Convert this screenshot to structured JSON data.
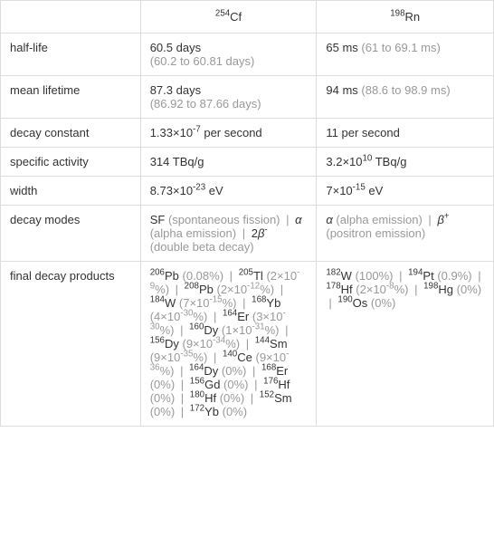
{
  "headers": {
    "col1_mass": "254",
    "col1_symbol": "Cf",
    "col2_mass": "198",
    "col2_symbol": "Rn"
  },
  "rows": {
    "halflife": {
      "label": "half-life",
      "col1_main": "60.5 days",
      "col1_sub": "(60.2 to 60.81 days)",
      "col2_main": "65 ms",
      "col2_sub": "(61 to 69.1 ms)"
    },
    "meanlifetime": {
      "label": "mean lifetime",
      "col1_main": "87.3 days",
      "col1_sub": "(86.92 to 87.66 days)",
      "col2_main": "94 ms",
      "col2_sub": "(88.6 to 98.9 ms)"
    },
    "decayconstant": {
      "label": "decay constant",
      "col1_base": "1.33×10",
      "col1_exp": "-7",
      "col1_unit": " per second",
      "col2": "11 per second"
    },
    "specificactivity": {
      "label": "specific activity",
      "col1": "314 TBq/g",
      "col2_base": "3.2×10",
      "col2_exp": "10",
      "col2_unit": " TBq/g"
    },
    "width": {
      "label": "width",
      "col1_base": "8.73×10",
      "col1_exp": "-23",
      "col1_unit": " eV",
      "col2_base": "7×10",
      "col2_exp": "-15",
      "col2_unit": " eV"
    },
    "decaymodes": {
      "label": "decay modes",
      "col1_p1a": "SF",
      "col1_p1b": " (spontaneous fission)",
      "col1_p2a": "α",
      "col1_p2b": " (alpha emission)",
      "col1_p3a": "2",
      "col1_p3b": "β",
      "col1_p3sup": "-",
      "col1_p3c": " (double beta decay)",
      "col2_p1a": "α",
      "col2_p1b": " (alpha emission)",
      "col2_p2a": "β",
      "col2_p2sup": "+",
      "col2_p2b": " (positron emission)"
    },
    "finaldecay": {
      "label": "final decay products",
      "sep": "|",
      "col1": [
        {
          "mass": "206",
          "sym": "Pb",
          "pct": "(0.08%)"
        },
        {
          "mass": "205",
          "sym": "Tl",
          "pct_pre": "(2×10",
          "pct_exp": "-9",
          "pct_post": "%)"
        },
        {
          "mass": "208",
          "sym": "Pb",
          "pct_pre": "(2×10",
          "pct_exp": "-12",
          "pct_post": "%)"
        },
        {
          "mass": "184",
          "sym": "W",
          "pct_pre": "(7×10",
          "pct_exp": "-15",
          "pct_post": "%)"
        },
        {
          "mass": "168",
          "sym": "Yb",
          "pct_pre": "(4×10",
          "pct_exp": "-30",
          "pct_post": "%)"
        },
        {
          "mass": "164",
          "sym": "Er",
          "pct_pre": "(3×10",
          "pct_exp": "-30",
          "pct_post": "%)"
        },
        {
          "mass": "160",
          "sym": "Dy",
          "pct_pre": "(1×10",
          "pct_exp": "-31",
          "pct_post": "%)"
        },
        {
          "mass": "156",
          "sym": "Dy",
          "pct_pre": "(9×10",
          "pct_exp": "-34",
          "pct_post": "%)"
        },
        {
          "mass": "144",
          "sym": "Sm",
          "pct_pre": "(9×10",
          "pct_exp": "-35",
          "pct_post": "%)"
        },
        {
          "mass": "140",
          "sym": "Ce",
          "pct_pre": "(9×10",
          "pct_exp": "-36",
          "pct_post": "%)"
        },
        {
          "mass": "164",
          "sym": "Dy",
          "pct": "(0%)"
        },
        {
          "mass": "168",
          "sym": "Er",
          "pct": "(0%)"
        },
        {
          "mass": "156",
          "sym": "Gd",
          "pct": "(0%)"
        },
        {
          "mass": "176",
          "sym": "Hf",
          "pct": "(0%)"
        },
        {
          "mass": "180",
          "sym": "Hf",
          "pct": "(0%)"
        },
        {
          "mass": "152",
          "sym": "Sm",
          "pct": "(0%)"
        },
        {
          "mass": "172",
          "sym": "Yb",
          "pct": "(0%)"
        }
      ],
      "col2": [
        {
          "mass": "182",
          "sym": "W",
          "pct": "(100%)"
        },
        {
          "mass": "194",
          "sym": "Pt",
          "pct": "(0.9%)"
        },
        {
          "mass": "178",
          "sym": "Hf",
          "pct_pre": "(2×10",
          "pct_exp": "-8",
          "pct_post": "%)"
        },
        {
          "mass": "198",
          "sym": "Hg",
          "pct": "(0%)"
        },
        {
          "mass": "190",
          "sym": "Os",
          "pct": "(0%)"
        }
      ]
    }
  }
}
